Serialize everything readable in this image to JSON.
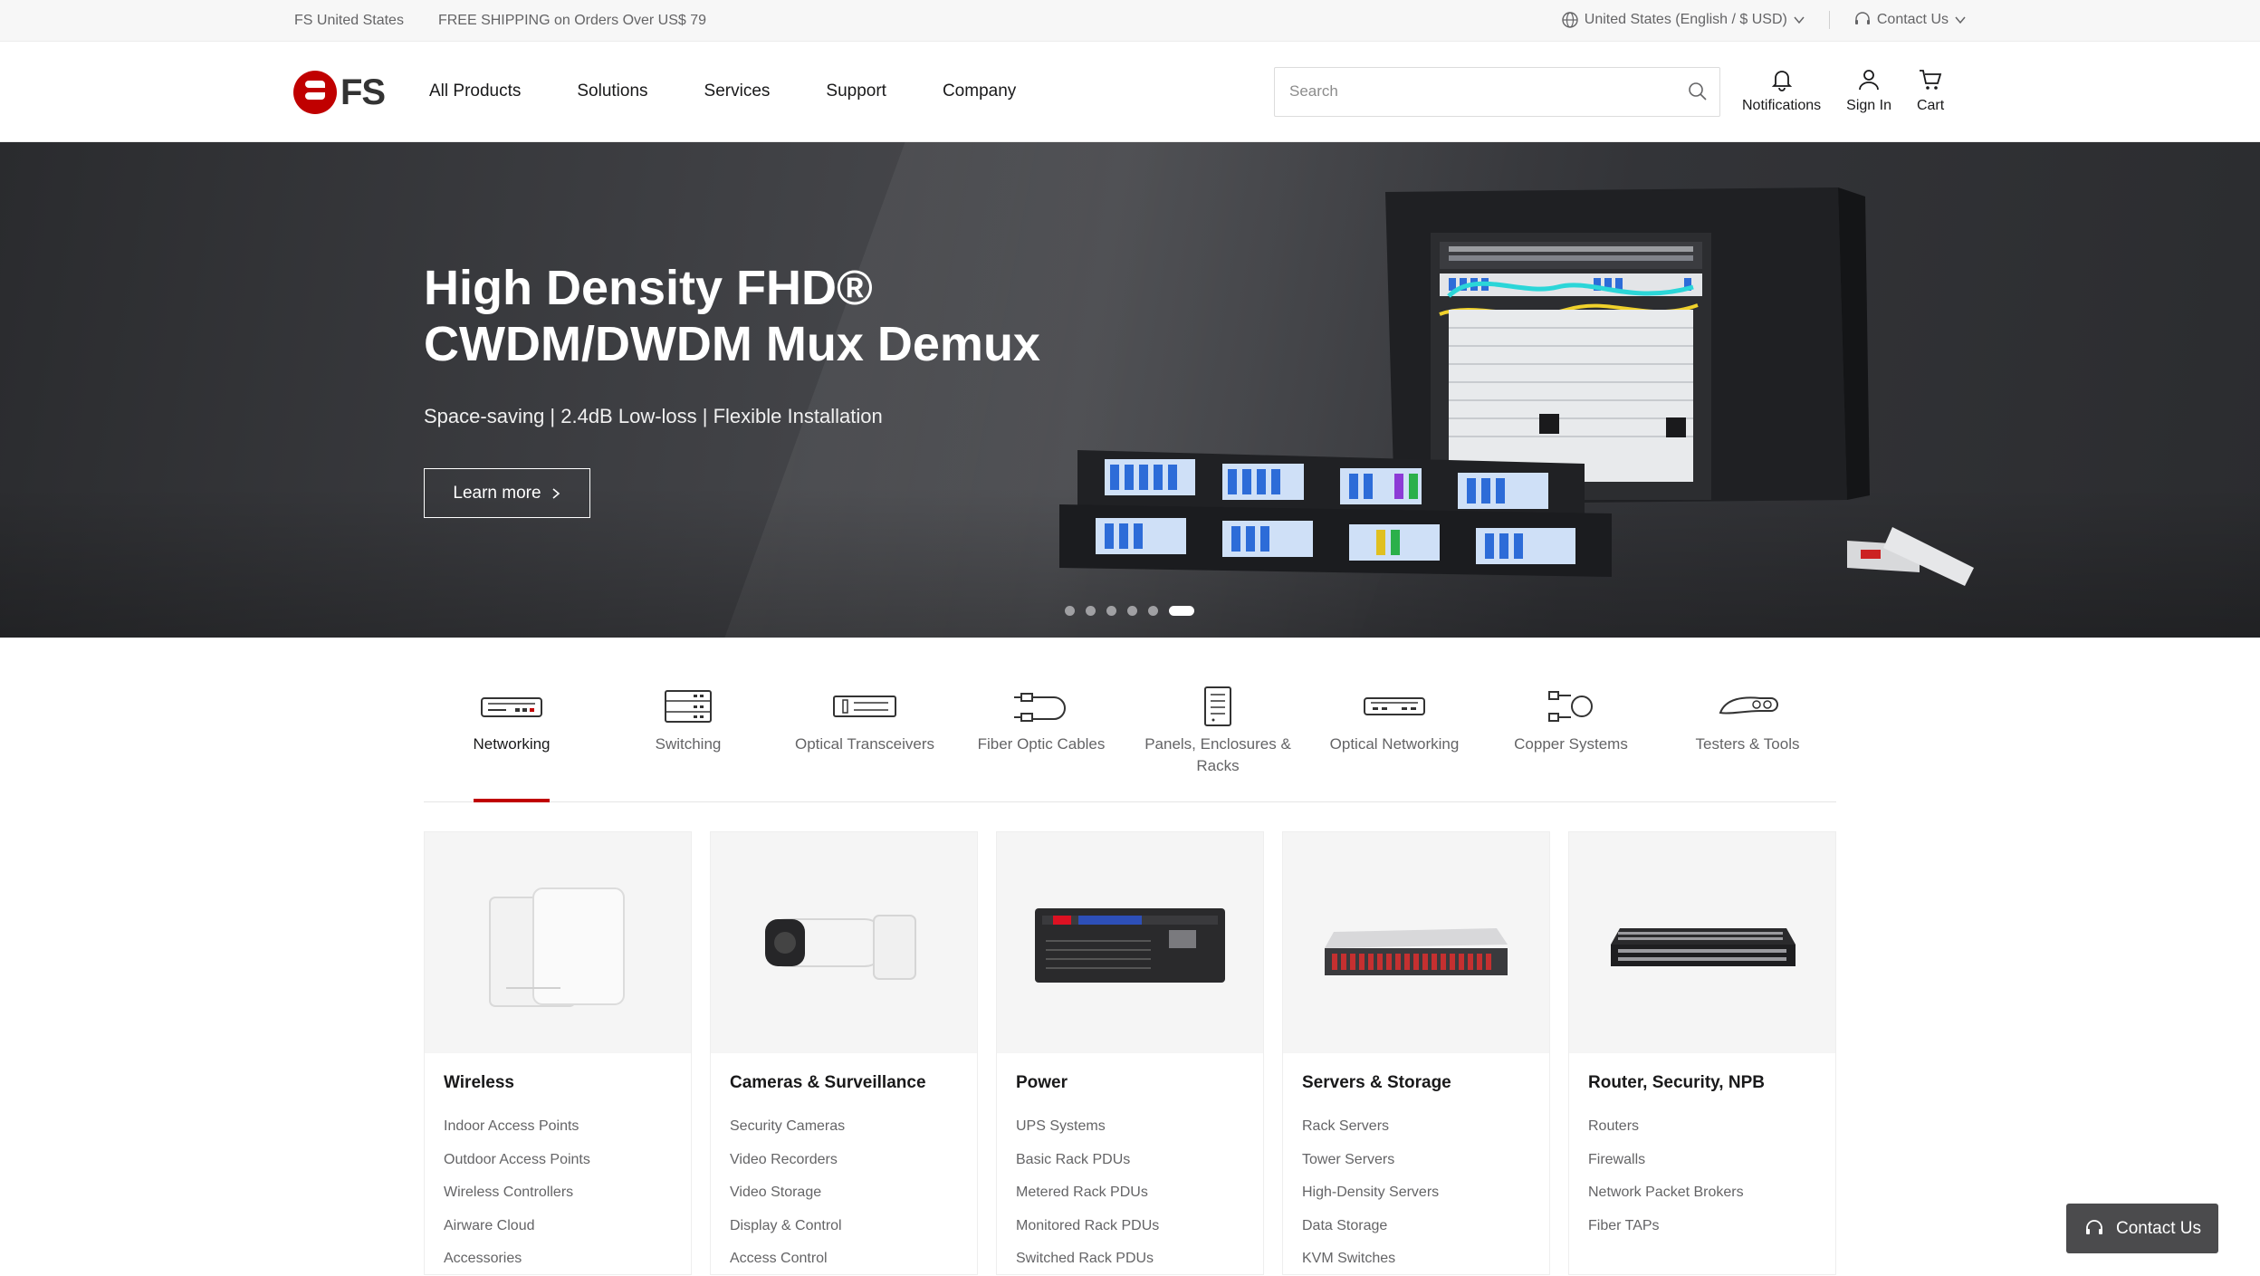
{
  "topbar": {
    "site": "FS United States",
    "promo": "FREE SHIPPING on Orders Over US$ 79",
    "region": "United States (English / $ USD)",
    "contact": "Contact Us"
  },
  "header": {
    "logo_text": "FS",
    "nav": [
      "All Products",
      "Solutions",
      "Services",
      "Support",
      "Company"
    ],
    "search_placeholder": "Search",
    "notifications": "Notifications",
    "sign_in": "Sign In",
    "cart": "Cart"
  },
  "hero": {
    "title_line1": "High Density FHD®",
    "title_line2": "CWDM/DWDM Mux Demux",
    "subtitle": "Space-saving | 2.4dB Low-loss | Flexible Installation",
    "cta": "Learn more",
    "slides_total": 6,
    "active_slide": 6
  },
  "categories": {
    "active": "Networking",
    "items": [
      {
        "label": "Networking",
        "icon": "network-device-icon"
      },
      {
        "label": "Switching",
        "icon": "switch-icon"
      },
      {
        "label": "Optical Transceivers",
        "icon": "transceiver-icon"
      },
      {
        "label": "Fiber Optic Cables",
        "icon": "fiber-cable-icon"
      },
      {
        "label": "Panels, Enclosures & Racks",
        "icon": "rack-icon"
      },
      {
        "label": "Optical Networking",
        "icon": "optical-network-icon"
      },
      {
        "label": "Copper Systems",
        "icon": "copper-cable-icon"
      },
      {
        "label": "Testers & Tools",
        "icon": "tester-icon"
      }
    ]
  },
  "cards": [
    {
      "title": "Wireless",
      "links": [
        "Indoor Access Points",
        "Outdoor Access Points",
        "Wireless Controllers",
        "Airware Cloud",
        "Accessories"
      ]
    },
    {
      "title": "Cameras & Surveillance",
      "links": [
        "Security Cameras",
        "Video Recorders",
        "Video Storage",
        "Display & Control",
        "Access Control"
      ]
    },
    {
      "title": "Power",
      "links": [
        "UPS Systems",
        "Basic Rack PDUs",
        "Metered Rack PDUs",
        "Monitored Rack PDUs",
        "Switched Rack PDUs"
      ]
    },
    {
      "title": "Servers & Storage",
      "links": [
        "Rack Servers",
        "Tower Servers",
        "High-Density Servers",
        "Data Storage",
        "KVM Switches"
      ]
    },
    {
      "title": "Router, Security, NPB",
      "links": [
        "Routers",
        "Firewalls",
        "Network Packet Brokers",
        "Fiber TAPs"
      ]
    }
  ],
  "chat": {
    "label": "Contact Us"
  },
  "colors": {
    "accent": "#c00000",
    "text": "#19191a",
    "muted": "#646466",
    "chat_bg": "#4b4b4d"
  }
}
